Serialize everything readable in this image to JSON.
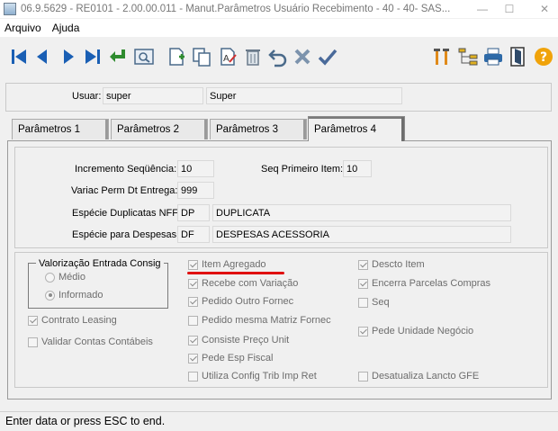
{
  "window": {
    "title": "06.9.5629 - RE0101 - 2.00.00.011 - Manut.Parâmetros Usuário Recebimento - 40 - 40- SAS...",
    "minimize": "—",
    "maximize": "☐",
    "close": "✕"
  },
  "menu": [
    "Arquivo",
    "Ajuda"
  ],
  "toolbar": {
    "icons": [
      "first-record-icon",
      "previous-record-icon",
      "next-record-icon",
      "last-record-icon",
      "goto-icon",
      "search-icon",
      "new-record-icon",
      "copy-record-icon",
      "edit-record-icon",
      "delete-record-icon",
      "undo-icon",
      "cancel-icon",
      "save-icon",
      "tools-icon",
      "tree-icon",
      "print-icon",
      "exit-icon",
      "help-icon"
    ]
  },
  "user": {
    "label": "Usuar:",
    "code": "super",
    "name": "Super"
  },
  "tabs": [
    "Parâmetros 1",
    "Parâmetros 2",
    "Parâmetros 3",
    "Parâmetros 4"
  ],
  "active_tab": "Parâmetros 4",
  "fields": {
    "incremento_label": "Incremento Seqüência:",
    "incremento_value": "10",
    "seq_primeiro_label": "Seq Primeiro Item:",
    "seq_primeiro_value": "10",
    "variac_label": "Variac Perm Dt Entrega:",
    "variac_value": "999",
    "especie_dup_label": "Espécie Duplicatas NFF:",
    "especie_dup_code": "DP",
    "especie_dup_desc": "DUPLICATA",
    "especie_desp_label": "Espécie para Despesas:",
    "especie_desp_code": "DF",
    "especie_desp_desc": "DESPESAS ACESSORIA"
  },
  "valorizacao": {
    "title": "Valorização Entrada Consig",
    "options": [
      "Médio",
      "Informado"
    ],
    "selected": "Informado"
  },
  "checkboxes_left": [
    {
      "label": "Contrato Leasing",
      "checked": true
    },
    {
      "label": "Validar Contas Contábeis",
      "checked": false
    }
  ],
  "checkboxes_middle": [
    {
      "label": "Item Agregado",
      "checked": true
    },
    {
      "label": "Recebe com Variação",
      "checked": true
    },
    {
      "label": "Pedido Outro Fornec",
      "checked": true
    },
    {
      "label": "Pedido mesma Matriz Fornec",
      "checked": false
    },
    {
      "label": "Consiste Preço Unit",
      "checked": true
    },
    {
      "label": "Pede Esp Fiscal",
      "checked": true
    },
    {
      "label": "Utiliza Config Trib Imp Ret",
      "checked": false
    }
  ],
  "checkboxes_right": [
    {
      "label": "Descto Item",
      "checked": true
    },
    {
      "label": "Encerra Parcelas Compras",
      "checked": true
    },
    {
      "label": "Seq",
      "checked": false
    },
    {
      "label": "Pede Unidade Negócio",
      "checked": true
    },
    {
      "label": "Desatualiza Lancto GFE",
      "checked": false
    }
  ],
  "status": "Enter data or press ESC to end.",
  "colors": {
    "highlight_underline": "#e01010",
    "nav_blue": "#1a5fb4",
    "help_orange": "#f0a30a"
  }
}
